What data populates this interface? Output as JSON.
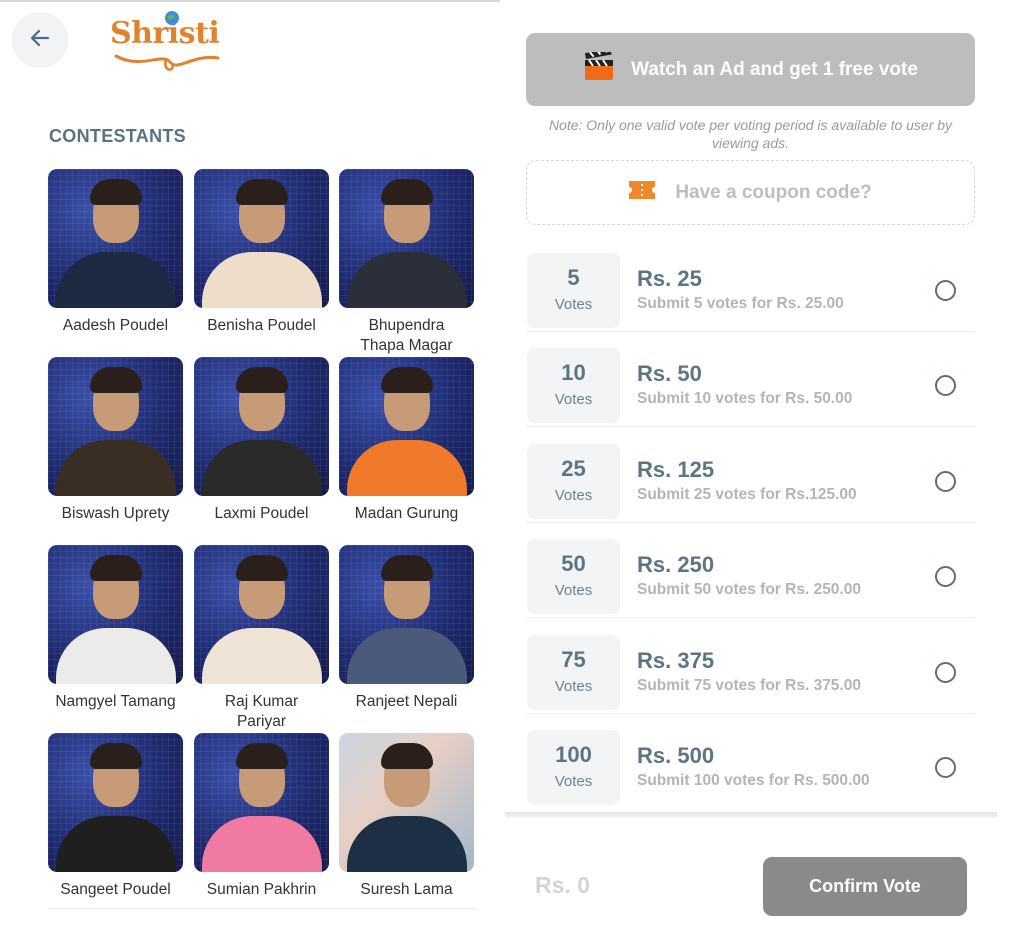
{
  "header": {
    "back_icon": "arrow-left-icon",
    "logo_text": "Shristi"
  },
  "contestants": {
    "title": "CONTESTANTS",
    "items": [
      {
        "name": "Aadesh Poudel",
        "outfit": "#1d2a44",
        "bg": "studio"
      },
      {
        "name": "Benisha Poudel",
        "outfit": "#efdccb",
        "bg": "studio"
      },
      {
        "name": "Bhupendra Thapa Magar",
        "outfit": "#2b2f3a",
        "bg": "studio"
      },
      {
        "name": "Biswash Uprety",
        "outfit": "#3a2e24",
        "bg": "studio"
      },
      {
        "name": "Laxmi Poudel",
        "outfit": "#2a2a2a",
        "bg": "studio"
      },
      {
        "name": "Madan Gurung",
        "outfit": "#ee7a2a",
        "bg": "studio"
      },
      {
        "name": "Namgyel Tamang",
        "outfit": "#ecebea",
        "bg": "studio"
      },
      {
        "name": "Raj Kumar Pariyar",
        "outfit": "#efe4d6",
        "bg": "studio"
      },
      {
        "name": "Ranjeet Nepali",
        "outfit": "#4b5a7a",
        "bg": "studio"
      },
      {
        "name": "Sangeet Poudel",
        "outfit": "#1f1f1f",
        "bg": "studio"
      },
      {
        "name": "Sumian Pakhrin",
        "outfit": "#f07aa2",
        "bg": "studio"
      },
      {
        "name": "Suresh Lama",
        "outfit": "#1d2f45",
        "bg": "street"
      }
    ]
  },
  "ad": {
    "icon": "clapperboard-icon",
    "label": "Watch an Ad and get 1 free vote",
    "note": "Note: Only one valid vote per voting period is available to user by viewing ads."
  },
  "coupon": {
    "icon": "ticket-icon",
    "label": "Have a coupon code?"
  },
  "vote_options": [
    {
      "count": "5",
      "unit": "Votes",
      "price": "Rs. 25",
      "desc": "Submit 5 votes for Rs. 25.00",
      "selected": false
    },
    {
      "count": "10",
      "unit": "Votes",
      "price": "Rs. 50",
      "desc": "Submit 10 votes for Rs. 50.00",
      "selected": false
    },
    {
      "count": "25",
      "unit": "Votes",
      "price": "Rs. 125",
      "desc": "Submit 25 votes for Rs.125.00",
      "selected": false
    },
    {
      "count": "50",
      "unit": "Votes",
      "price": "Rs. 250",
      "desc": "Submit 50 votes for Rs. 250.00",
      "selected": false
    },
    {
      "count": "75",
      "unit": "Votes",
      "price": "Rs. 375",
      "desc": "Submit 75 votes for Rs. 375.00",
      "selected": false
    },
    {
      "count": "100",
      "unit": "Votes",
      "price": "Rs. 500",
      "desc": "Submit 100 votes for Rs. 500.00",
      "selected": false
    }
  ],
  "footer": {
    "total": "Rs. 0",
    "confirm_label": "Confirm Vote"
  },
  "colors": {
    "brand_orange": "#e0822e",
    "accent_slate": "#5c7583",
    "button_disabled": "#8a8a8a"
  }
}
